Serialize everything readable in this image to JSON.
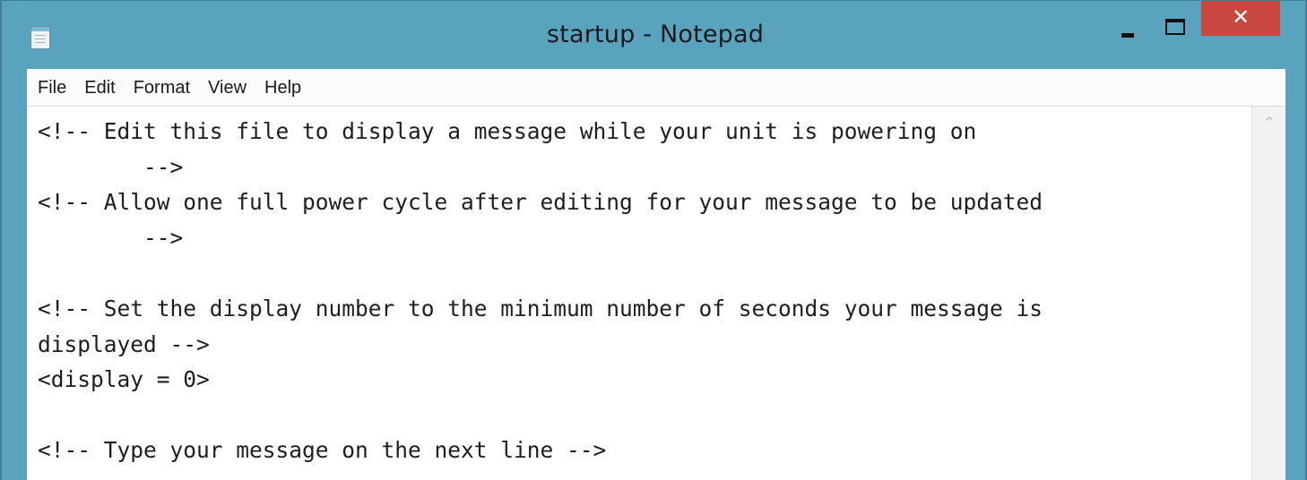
{
  "window": {
    "title": "startup - Notepad",
    "close_glyph": "✕"
  },
  "menu": {
    "items": [
      "File",
      "Edit",
      "Format",
      "View",
      "Help"
    ]
  },
  "editor": {
    "content": "<!-- Edit this file to display a message while your unit is powering on\n        -->\n<!-- Allow one full power cycle after editing for your message to be updated\n        -->\n\n<!-- Set the display number to the minimum number of seconds your message is\ndisplayed -->\n<display = 0>\n\n<!-- Type your message on the next line -->"
  },
  "scrollbar": {
    "up_glyph": "^"
  },
  "icons": {
    "app": "notepad-icon",
    "minimize": "minimize-icon",
    "maximize": "maximize-icon",
    "close": "close-icon",
    "scroll_up": "chevron-up-icon"
  },
  "colors": {
    "titlebar": "#5aa3be",
    "close_button": "#c9473e"
  }
}
